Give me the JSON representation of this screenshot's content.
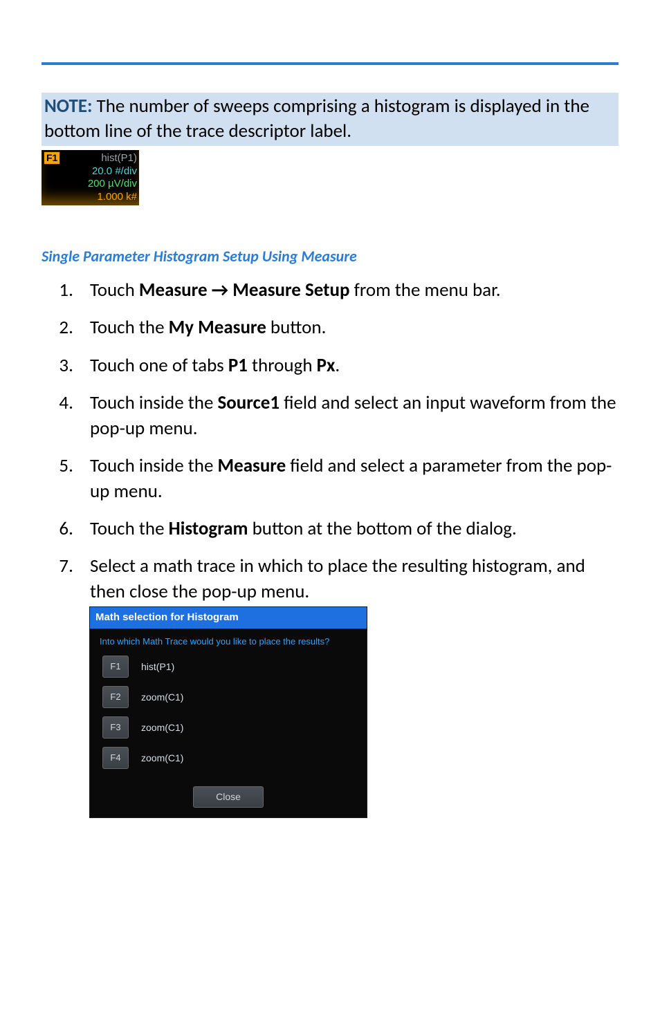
{
  "note": {
    "label": "NOTE:",
    "text": " The number of sweeps comprising a histogram is displayed in the bottom line of the trace descriptor label."
  },
  "trace": {
    "badge": "F1",
    "l1": "hist(P1)",
    "l2": "20.0 #/div",
    "l3": "200 µV/div",
    "l4": "1.000 k#"
  },
  "section_title": "Single Parameter Histogram Setup Using Measure",
  "steps": {
    "s1a": "Touch ",
    "s1b": "Measure ",
    "s1arrow": "→",
    "s1c": " Measure Setup",
    "s1d": " from the menu bar.",
    "s2a": "Touch the ",
    "s2b": "My Measure",
    "s2c": " button.",
    "s3a": "Touch one of tabs ",
    "s3b": "P1",
    "s3c": " through ",
    "s3d": "Px",
    "s3e": ".",
    "s4a": "Touch inside the ",
    "s4b": "Source1",
    "s4c": " field and select an input waveform from the pop-up menu.",
    "s5a": "Touch inside the ",
    "s5b": "Measure",
    "s5c": " field and select a parameter from the pop-up menu.",
    "s6a": "Touch the ",
    "s6b": "Histogram",
    "s6c": " button at the bottom of the dialog.",
    "s7": "Select a math trace in which to place the resulting histogram, and then close the pop-up menu."
  },
  "popup": {
    "title": "Math selection for Histogram",
    "subtitle": "Into which Math Trace would you like to place the results?",
    "rows": [
      {
        "btn": "F1",
        "txt": "hist(P1)"
      },
      {
        "btn": "F2",
        "txt": "zoom(C1)"
      },
      {
        "btn": "F3",
        "txt": "zoom(C1)"
      },
      {
        "btn": "F4",
        "txt": "zoom(C1)"
      }
    ],
    "close": "Close"
  }
}
